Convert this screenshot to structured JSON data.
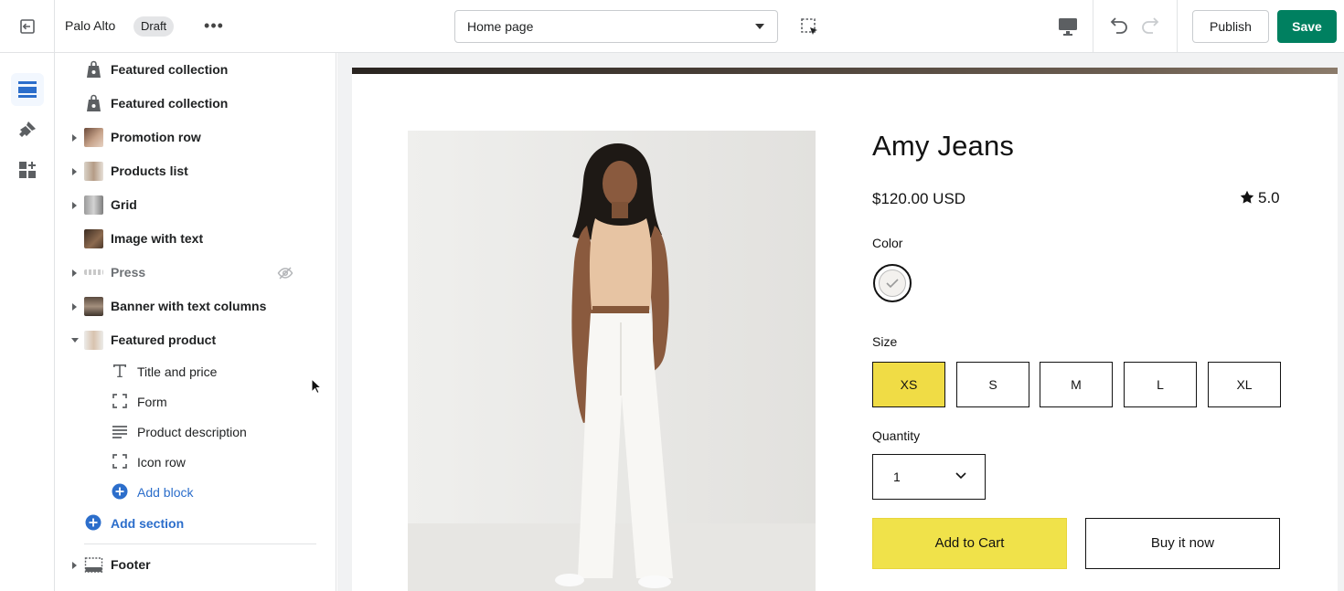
{
  "topbar": {
    "store_name": "Palo Alto",
    "status_badge": "Draft",
    "page_select": "Home page",
    "publish_label": "Publish",
    "save_label": "Save"
  },
  "sidebar": {
    "items": [
      {
        "label": "Featured collection"
      },
      {
        "label": "Featured collection"
      },
      {
        "label": "Promotion row"
      },
      {
        "label": "Products list"
      },
      {
        "label": "Grid"
      },
      {
        "label": "Image with text"
      },
      {
        "label": "Press"
      },
      {
        "label": "Banner with text columns"
      },
      {
        "label": "Featured product"
      }
    ],
    "blocks": [
      {
        "label": "Title and price"
      },
      {
        "label": "Form"
      },
      {
        "label": "Product description"
      },
      {
        "label": "Icon row"
      }
    ],
    "add_block": "Add block",
    "add_section": "Add section",
    "footer": "Footer"
  },
  "product": {
    "title": "Amy Jeans",
    "price": "$120.00 USD",
    "rating": "5.0",
    "color_label": "Color",
    "size_label": "Size",
    "sizes": [
      "XS",
      "S",
      "M",
      "L",
      "XL"
    ],
    "selected_size": "XS",
    "quantity_label": "Quantity",
    "quantity": "1",
    "add_to_cart": "Add to Cart",
    "buy_now": "Buy it now"
  },
  "colors": {
    "accent_green": "#008060",
    "cta_yellow": "#f0e24a",
    "selected_size": "#f0dc45",
    "link_blue": "#2c6ecb"
  }
}
